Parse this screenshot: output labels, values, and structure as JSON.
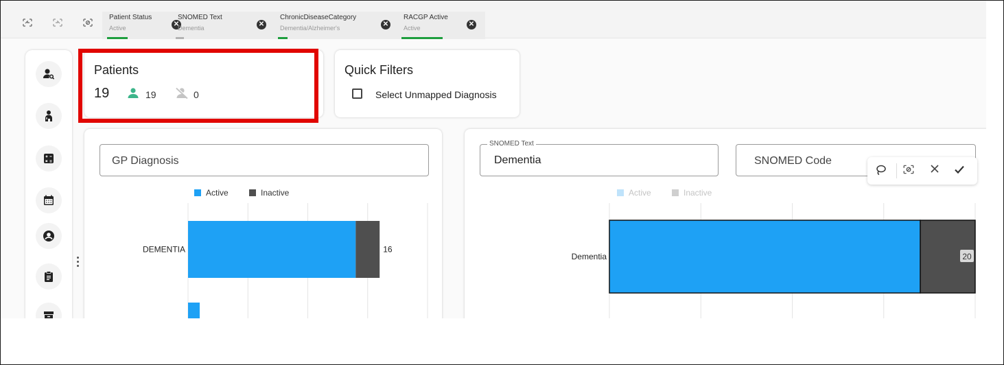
{
  "topbar": {
    "tools": [
      "undo-icon",
      "redo-icon",
      "clear-selection-icon"
    ],
    "chips": [
      {
        "title": "Patient Status",
        "value": "Active"
      },
      {
        "title": "SNOMED Text",
        "value": "Dementia"
      },
      {
        "title": "ChronicDiseaseCategory",
        "value": "Dementia/Alzheimer's"
      },
      {
        "title": "RACGP Active",
        "value": "Active"
      }
    ]
  },
  "nav": {
    "items": [
      "patient-search-icon",
      "patient-icon",
      "calculator-icon",
      "calendar-icon",
      "account-circle-icon",
      "clipboard-icon",
      "archive-icon"
    ]
  },
  "patients": {
    "title": "Patients",
    "total": "19",
    "active": "19",
    "inactive": "0"
  },
  "quick_filters": {
    "title": "Quick Filters",
    "option": "Select Unmapped Diagnosis"
  },
  "gp_panel": {
    "placeholder": "GP Diagnosis"
  },
  "snomed_panel": {
    "text_label": "SNOMED Text",
    "text_value": "Dementia",
    "code_placeholder": "SNOMED Code"
  },
  "selection_toolbar": [
    "lasso-icon",
    "clear-selection-icon",
    "cancel-icon",
    "confirm-icon"
  ],
  "colors": {
    "active": "#1ea1f5",
    "inactive": "#4f4f4f",
    "active_faded": "#bfe3fb",
    "inactive_faded": "#cfcfcf",
    "patient_icon": "#3cb58a",
    "highlight": "#e10600",
    "chip_underline": "#1e9e3e"
  },
  "chart_data": [
    {
      "type": "bar",
      "orientation": "horizontal",
      "stacked": true,
      "categories": [
        "DEMENTIA"
      ],
      "series": [
        {
          "name": "Active",
          "values": [
            14
          ]
        },
        {
          "name": "Inactive",
          "values": [
            2
          ]
        }
      ],
      "data_labels": [
        "16"
      ],
      "legend": "top",
      "grid": true,
      "xlim": [
        0,
        20
      ]
    },
    {
      "type": "bar",
      "orientation": "horizontal",
      "stacked": true,
      "categories": [
        "Dementia"
      ],
      "series": [
        {
          "name": "Active",
          "values": [
            17
          ]
        },
        {
          "name": "Inactive",
          "values": [
            3
          ]
        }
      ],
      "data_labels": [
        "20"
      ],
      "legend": "top",
      "grid": true,
      "xlim": [
        0,
        20
      ]
    }
  ]
}
